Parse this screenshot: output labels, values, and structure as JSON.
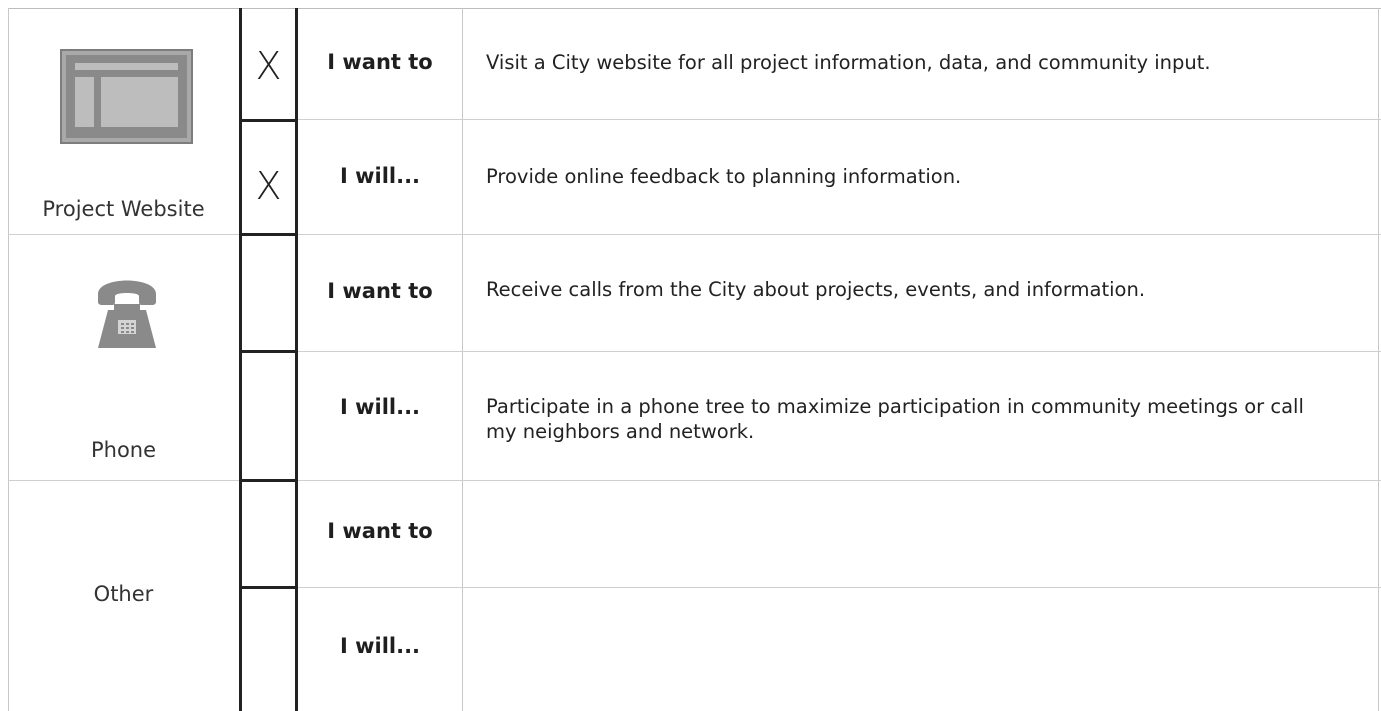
{
  "top_fragment": {
    "part_a": "",
    "part_b": ""
  },
  "rows": [
    {
      "channel": "Project Website",
      "icon": "website-icon",
      "entries": [
        {
          "phrase": "I want to",
          "checked": true,
          "mark": "X",
          "text": "Visit a City website for all project information, data, and community input."
        },
        {
          "phrase": "I will...",
          "checked": true,
          "mark": "X",
          "text": "Provide online feedback to planning information."
        }
      ]
    },
    {
      "channel": "Phone",
      "icon": "telephone-icon",
      "entries": [
        {
          "phrase": "I want to",
          "checked": false,
          "mark": "",
          "text": "Receive calls from the City about projects, events, and information."
        },
        {
          "phrase": "I will...",
          "checked": false,
          "mark": "",
          "text": "Participate in a phone tree to maximize participation in community meetings or call my neighbors and network."
        }
      ]
    },
    {
      "channel": "Other",
      "icon": "",
      "entries": [
        {
          "phrase": "I want to",
          "checked": false,
          "mark": "",
          "text": ""
        },
        {
          "phrase": "I will...",
          "checked": false,
          "mark": "",
          "text": ""
        }
      ]
    }
  ],
  "colors": {
    "icon_gray": "#8a8a8a",
    "grid_line": "#c9c9c9",
    "check_border": "#222222"
  }
}
